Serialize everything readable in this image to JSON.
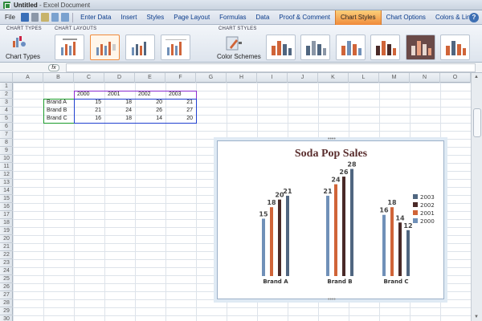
{
  "window": {
    "app_name": "Untitled",
    "title_suffix": " - Excel Document"
  },
  "menu": {
    "file": "File",
    "tabs": [
      {
        "label": "Enter Data"
      },
      {
        "label": "Insert"
      },
      {
        "label": "Styles"
      },
      {
        "label": "Page Layout"
      },
      {
        "label": "Formulas"
      },
      {
        "label": "Data"
      },
      {
        "label": "Proof & Comment"
      },
      {
        "label": "Chart Styles",
        "active": true
      },
      {
        "label": "Chart Options"
      },
      {
        "label": "Colors & Lines"
      }
    ],
    "help": "?"
  },
  "ribbon": {
    "group_chart_types": "CHART TYPES",
    "group_chart_layouts": "CHART LAYOUTS",
    "group_chart_styles": "CHART STYLES",
    "chart_types_button": "Chart Types",
    "color_schemes_button": "Color Schemes"
  },
  "formula_bar": {
    "fx": "fx",
    "value": ""
  },
  "columns": [
    "A",
    "B",
    "C",
    "D",
    "E",
    "F",
    "G",
    "H",
    "I",
    "J",
    "K",
    "L",
    "M",
    "N",
    "O"
  ],
  "rows": [
    "1",
    "2",
    "3",
    "4",
    "5",
    "6",
    "7",
    "8",
    "9",
    "10",
    "11",
    "12",
    "13",
    "14",
    "15",
    "16",
    "17",
    "18",
    "19",
    "20",
    "21",
    "22",
    "23",
    "24",
    "25",
    "26",
    "27",
    "28",
    "29",
    "30"
  ],
  "sheet": {
    "years": [
      "2000",
      "2001",
      "2002",
      "2003"
    ],
    "brands": [
      {
        "name": "Brand A",
        "values": [
          15,
          18,
          20,
          21
        ]
      },
      {
        "name": "Brand B",
        "values": [
          21,
          24,
          26,
          27
        ]
      },
      {
        "name": "Brand C",
        "values": [
          16,
          18,
          14,
          20
        ]
      }
    ]
  },
  "colors": {
    "2000": "#7090b8",
    "2001": "#d06438",
    "2002": "#4a2a28",
    "2003": "#506680",
    "accent": "#f08a3a"
  },
  "chart_data": {
    "type": "bar",
    "title": "Soda Pop Sales",
    "categories": [
      "Brand A",
      "Brand B",
      "Brand C"
    ],
    "series": [
      {
        "name": "2000",
        "values": [
          15,
          21,
          16
        ]
      },
      {
        "name": "2001",
        "values": [
          18,
          24,
          18
        ]
      },
      {
        "name": "2002",
        "values": [
          20,
          26,
          14
        ]
      },
      {
        "name": "2003",
        "values": [
          21,
          28,
          12
        ]
      }
    ],
    "legend_order": [
      "2003",
      "2002",
      "2001",
      "2000"
    ],
    "legend_position": "right",
    "xlabel": "",
    "ylabel": "",
    "ylim": [
      0,
      30
    ],
    "grid": false
  }
}
